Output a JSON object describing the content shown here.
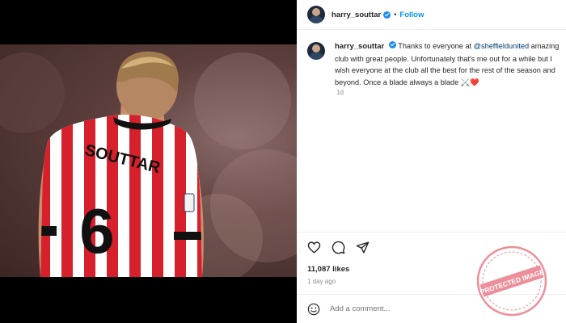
{
  "post": {
    "username": "harry_souttar",
    "follow_label": "Follow",
    "separator": "•",
    "caption_parts": {
      "before_mention": "Thanks to everyone at ",
      "mention": "@sheffieldunited",
      "after_mention": " amazing club with great people. Unfortunately that's me out for a while but I wish everyone at the club all the best for the rest of the season and beyond. Once a blade always a blade ",
      "emoji": "⚔️",
      "heart": "❤️"
    },
    "caption_age": "1d",
    "likes": "11,087 likes",
    "posted_ago": "1 day ago"
  },
  "photo": {
    "shirt_name": "SOUTTAR",
    "shirt_number": "6"
  },
  "comment": {
    "placeholder": "Add a comment..."
  },
  "watermark": {
    "main_text": "PROTECTED IMAGE"
  },
  "colors": {
    "accent": "#0095f6",
    "verified": "#1a8cf0",
    "shirt_red": "#d6202b",
    "stamp_red": "#e0455a"
  },
  "icons": [
    "verified-badge-icon",
    "heart-icon",
    "comment-icon",
    "share-icon",
    "emoji-icon"
  ]
}
